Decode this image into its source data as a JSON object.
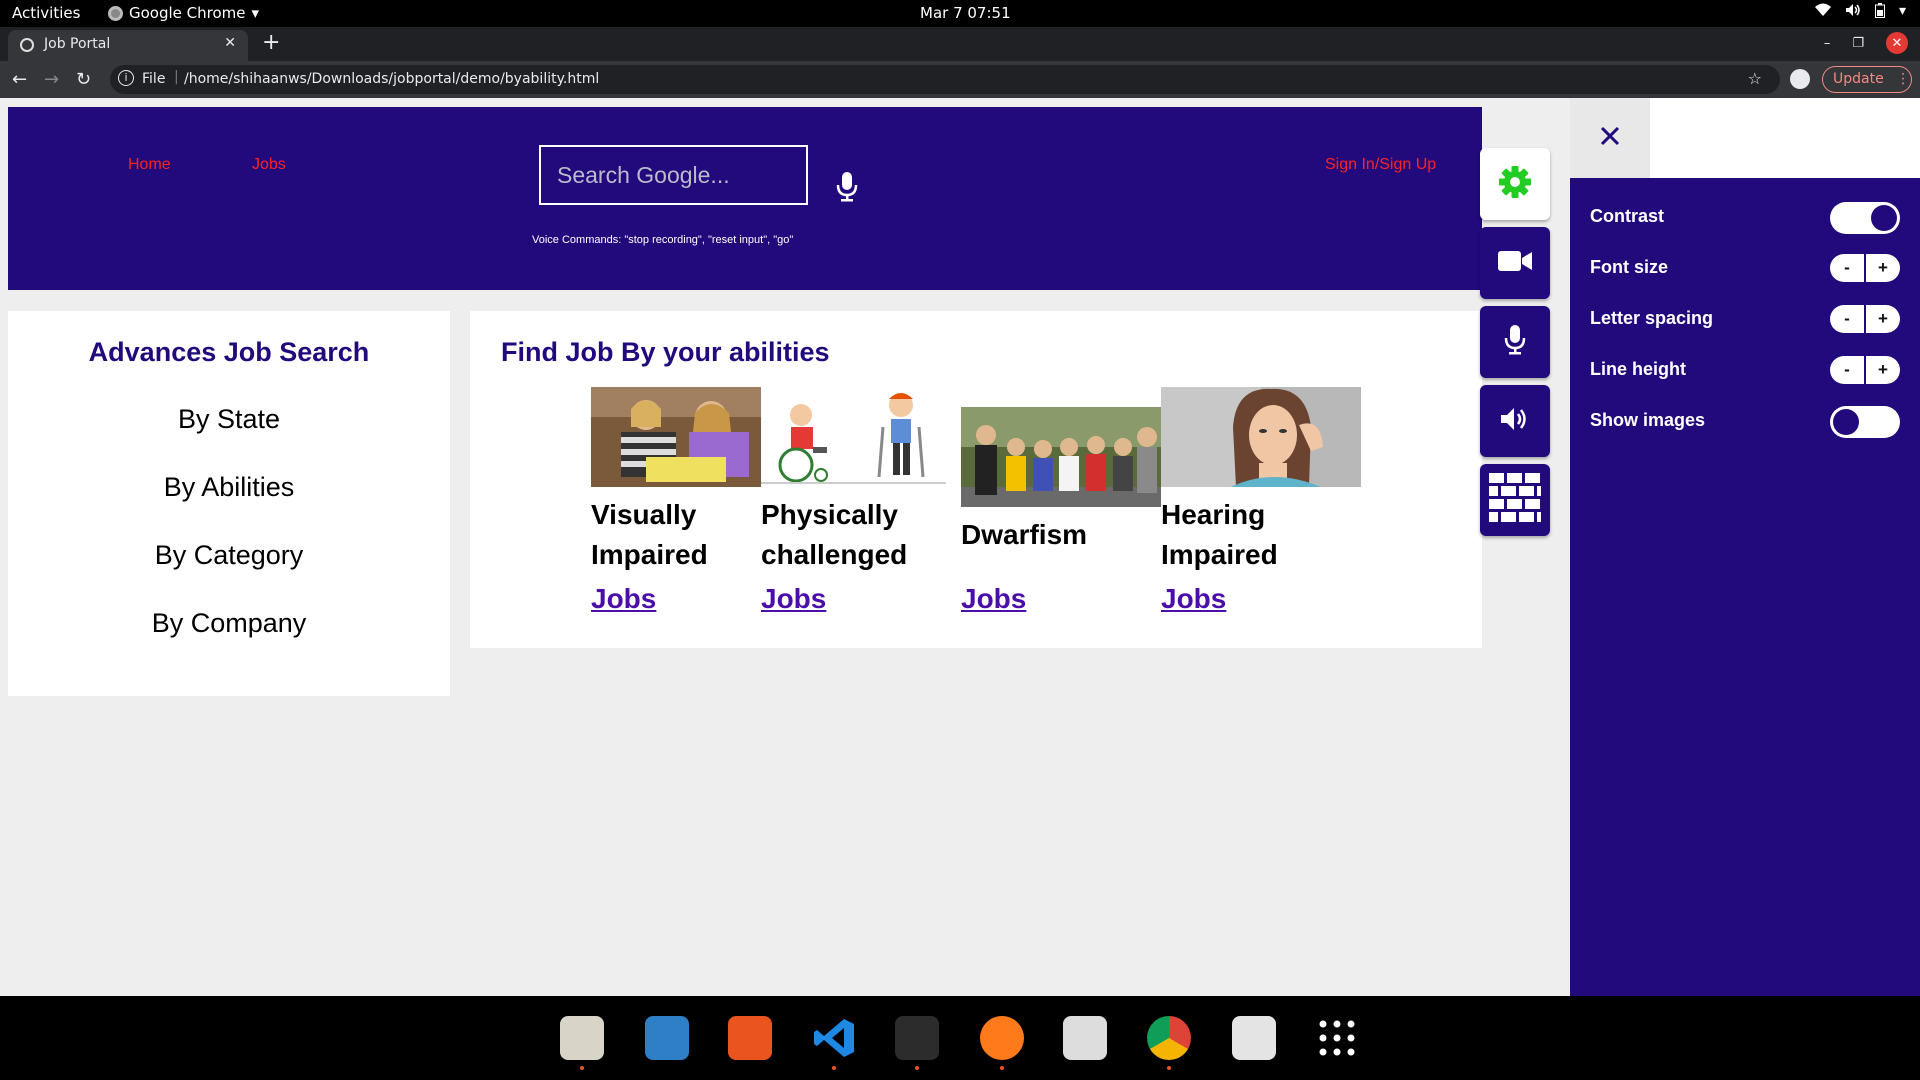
{
  "system_bar": {
    "activities": "Activities",
    "app_name": "Google Chrome",
    "clock": "Mar 7  07:51"
  },
  "browser": {
    "tab_title": "Job Portal",
    "url_scheme": "File",
    "url": "/home/shihaanws/Downloads/jobportal/demo/byability.html",
    "update_label": "Update"
  },
  "header": {
    "nav": {
      "home": "Home",
      "jobs": "Jobs"
    },
    "search_placeholder": "Search Google...",
    "voice_hint": "Voice Commands: \"stop recording\", \"reset input\", \"go\"",
    "signin": "Sign In/Sign Up"
  },
  "sidebar": {
    "title": "Advances Job Search",
    "options": [
      "By State",
      "By Abilities",
      "By Category",
      "By Company"
    ]
  },
  "main": {
    "title": "Find Job By your abilities",
    "abilities": [
      {
        "name": "Visually\nImpaired",
        "link": "Jobs"
      },
      {
        "name": "Physically\nchallenged",
        "link": "Jobs"
      },
      {
        "name": "Dwarfism",
        "link": "Jobs"
      },
      {
        "name": "Hearing\nImpaired",
        "link": "Jobs"
      }
    ]
  },
  "accessibility_panel": {
    "contrast": "Contrast",
    "contrast_on": true,
    "font_size": "Font size",
    "letter_spacing": "Letter spacing",
    "line_height": "Line height",
    "show_images": "Show images",
    "show_images_on": false,
    "minus": "-",
    "plus": "+"
  },
  "colors": {
    "brand": "#22097c",
    "nav_link": "#ff2222",
    "jobs_link": "#4b0eab",
    "gear": "#22cc22"
  }
}
